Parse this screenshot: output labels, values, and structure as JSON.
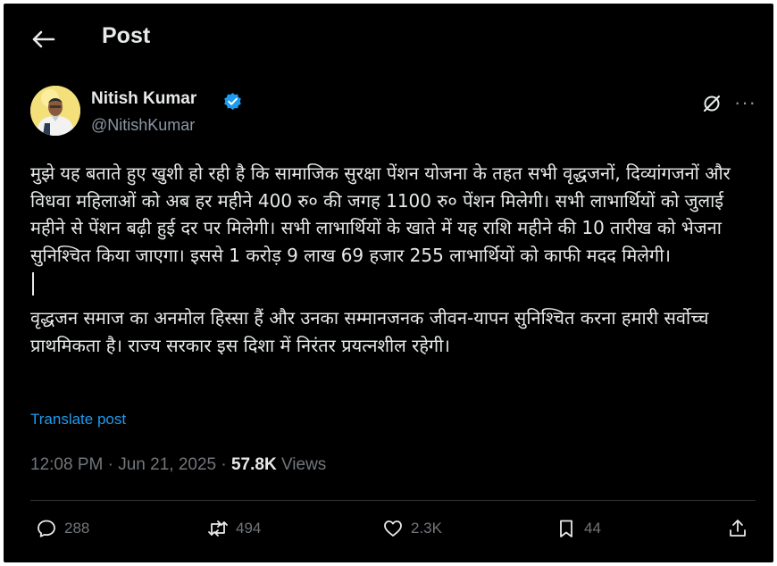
{
  "header": {
    "title": "Post",
    "back_icon": "arrow-left-icon"
  },
  "author": {
    "name": "Nitish Kumar",
    "handle": "@NitishKumar",
    "verified_icon": "verified-badge-icon",
    "verified_color": "#1d9bf0",
    "avatar_bg": "#f4e07a"
  },
  "post": {
    "paragraph1": "मुझे यह बताते हुए खुशी हो रही है कि सामाजिक सुरक्षा पेंशन योजना के तहत सभी वृद्धजनों, दिव्यांगजनों और विधवा महिलाओं को अब हर महीने 400 रु० की जगह 1100 रु० पेंशन मिलेगी। सभी लाभार्थियों को जुलाई महीने से पेंशन बढ़ी हुई दर पर मिलेगी। सभी लाभार्थियों के खाते में यह राशि महीने की 10 तारीख को भेजना सुनिश्चित किया जाएगा। इससे 1 करोड़ 9 लाख 69 हजार 255 लाभार्थियों को काफी मदद मिलेगी।",
    "paragraph2": "वृद्धजन समाज का अनमोल हिस्सा हैं और उनका सम्मानजनक जीवन-यापन सुनिश्चित करना हमारी सर्वोच्च प्राथमिकता है। राज्य सरकार इस दिशा में निरंतर प्रयत्नशील रहेगी।",
    "translate_label": "Translate post"
  },
  "meta": {
    "time": "12:08 PM",
    "separator": "·",
    "date": "Jun 21, 2025",
    "views_count": "57.8K",
    "views_label": "Views"
  },
  "actions": {
    "replies": "288",
    "reposts": "494",
    "likes": "2.3K",
    "bookmarks": "44"
  },
  "colors": {
    "background": "#000000",
    "text": "#e7e9ea",
    "secondary": "#71767b",
    "link": "#1d9bf0",
    "divider": "#2f3336"
  }
}
